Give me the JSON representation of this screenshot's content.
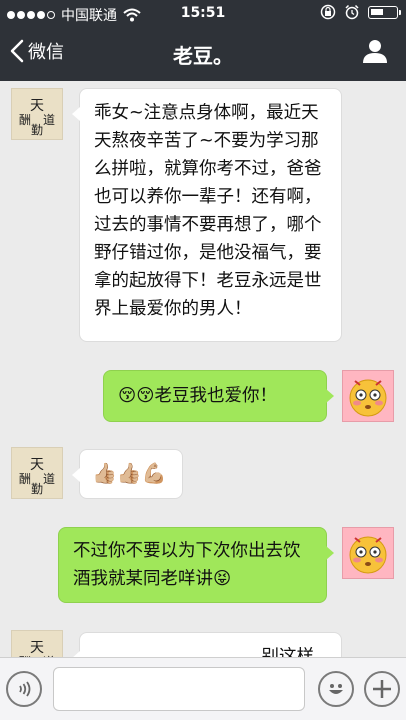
{
  "status_bar": {
    "carrier": "中国联通",
    "time": "15:51"
  },
  "nav": {
    "back_label": "微信",
    "title": "老豆。"
  },
  "messages": [
    {
      "side": "left",
      "text": "乖女~注意点身体啊，最近天天熬夜辛苦了~不要为学习那么拼啦，就算你考不过，爸爸也可以养你一辈子！还有啊，过去的事情不要再想了，哪个野仔错过你，是他没福气，要拿的起放得下！老豆永远是世界上最爱你的男人！"
    },
    {
      "side": "right",
      "text": "老豆我也爱你！",
      "emoji": "😚😚"
    },
    {
      "side": "left",
      "emoji": "👍🏼👍🏼💪🏼"
    },
    {
      "side": "right",
      "text": "不过你不要以为下次你出去饮酒我就某同老咩讲",
      "emoji_end": "😝"
    },
    {
      "side": "left",
      "text": "……………别这样嘿"
    }
  ],
  "calligraphy_chars": [
    "天",
    "道",
    "酬",
    "勤"
  ],
  "icons": {
    "voice": "voice-icon",
    "emoji": "smiley-icon",
    "plus": "plus-icon",
    "person": "person-icon",
    "wifi": "wifi-icon",
    "lock": "lock-icon",
    "alarm": "alarm-icon",
    "battery": "battery-icon"
  },
  "colors": {
    "header_bg": "#2e3238",
    "chat_bg": "#ebebeb",
    "green_bubble": "#a0e75a"
  }
}
